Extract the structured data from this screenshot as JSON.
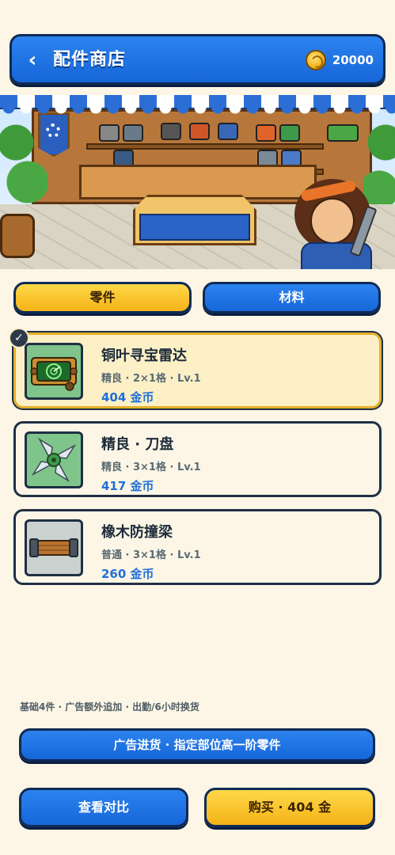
{
  "header": {
    "back_icon": "chevron-left-icon",
    "back_glyph": "‹",
    "title": "配件商店",
    "coin_icon": "gold-coin-icon",
    "coin_amount": "20000"
  },
  "tabs": [
    {
      "label": "零件",
      "active": true
    },
    {
      "label": "材料",
      "active": false
    }
  ],
  "items": [
    {
      "name": "铜叶寻宝雷达",
      "meta": "精良 · 2×1格 · Lv.1",
      "price": "404 金币",
      "icon": "radar-icon",
      "selected": true
    },
    {
      "name": "精良 · 刀盘",
      "meta": "精良 · 3×1格 · Lv.1",
      "price": "417 金币",
      "icon": "blade-disc-icon",
      "selected": false
    },
    {
      "name": "橡木防撞梁",
      "meta": "普通 · 3×1格 · Lv.1",
      "price": "260 金币",
      "icon": "bumper-beam-icon",
      "selected": false
    }
  ],
  "check_glyph": "✓",
  "footnote": "基础4件 · 广告额外追加 · 出勤/6小时换货",
  "buttons": {
    "ad_restock": "广告进货 · 指定部位高一阶零件",
    "compare": "查看对比",
    "buy": "购买 · 404 金"
  },
  "colors": {
    "primary_blue": "#1e6fd6",
    "accent_yellow": "#f5b316",
    "background": "#fdf6e6",
    "outline": "#0f2a55"
  }
}
